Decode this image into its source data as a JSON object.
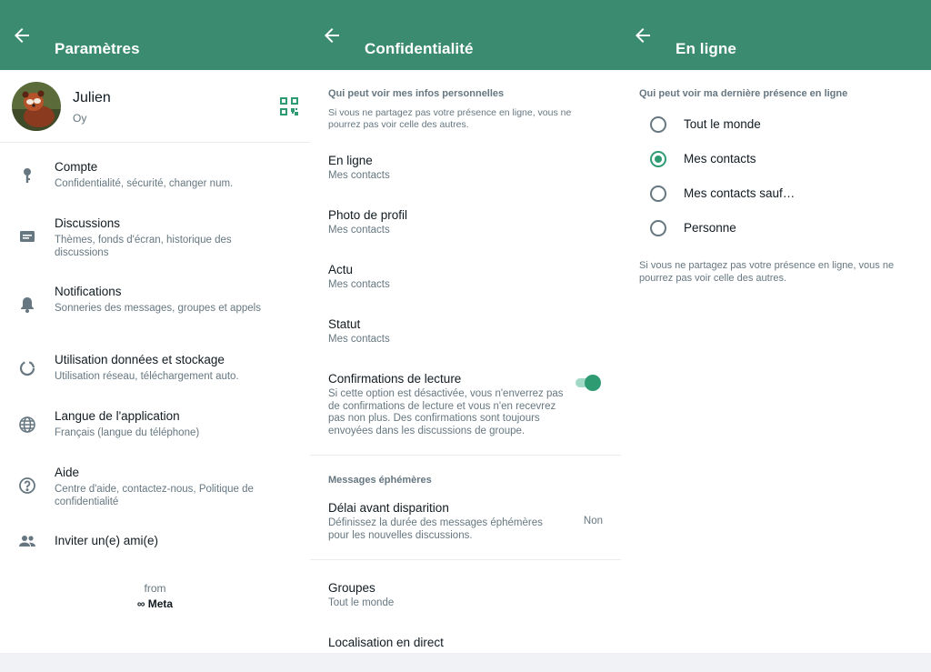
{
  "colors": {
    "header": "#3a8b70",
    "accent": "#2e9b73",
    "secondary_text": "#667781"
  },
  "settings": {
    "title": "Paramètres",
    "profile": {
      "name": "Julien",
      "status": "Oy"
    },
    "items": [
      {
        "icon": "key-icon",
        "title": "Compte",
        "subtitle": "Confidentialité, sécurité, changer num."
      },
      {
        "icon": "chat-icon",
        "title": "Discussions",
        "subtitle": "Thèmes, fonds d'écran, historique des discussions"
      },
      {
        "icon": "bell-icon",
        "title": "Notifications",
        "subtitle": "Sonneries des messages, groupes et appels"
      },
      {
        "icon": "data-usage-icon",
        "title": "Utilisation données et stockage",
        "subtitle": "Utilisation réseau, téléchargement auto."
      },
      {
        "icon": "globe-icon",
        "title": "Langue de l'application",
        "subtitle": "Français (langue du téléphone)"
      },
      {
        "icon": "help-icon",
        "title": "Aide",
        "subtitle": "Centre d'aide, contactez-nous, Politique de confidentialité"
      },
      {
        "icon": "people-icon",
        "title": "Inviter un(e) ami(e)",
        "subtitle": ""
      }
    ],
    "from_label": "from",
    "meta_label": "∞ Meta"
  },
  "privacy": {
    "title": "Confidentialité",
    "section1_header": "Qui peut voir mes infos personnelles",
    "section1_desc": "Si vous ne partagez pas votre présence en ligne, vous ne pourrez pas voir celle des autres.",
    "rows": [
      {
        "title": "En ligne",
        "value": "Mes contacts"
      },
      {
        "title": "Photo de profil",
        "value": "Mes contacts"
      },
      {
        "title": "Actu",
        "value": "Mes contacts"
      },
      {
        "title": "Statut",
        "value": "Mes contacts"
      }
    ],
    "read_receipts": {
      "title": "Confirmations de lecture",
      "desc": "Si cette option est désactivée, vous n'enverrez pas de confirmations de lecture et vous n'en recevrez pas non plus. Des confirmations sont toujours envoyées dans les discussions de groupe.",
      "enabled": true
    },
    "section2_header": "Messages éphémères",
    "disappearing": {
      "title": "Délai avant disparition",
      "desc": "Définissez la durée des messages éphémères pour les nouvelles discussions.",
      "value": "Non"
    },
    "groups": {
      "title": "Groupes",
      "value": "Tout le monde"
    },
    "live_location": {
      "title": "Localisation en direct"
    }
  },
  "online": {
    "title": "En ligne",
    "header": "Qui peut voir ma dernière présence en ligne",
    "options": [
      {
        "label": "Tout le monde",
        "checked": false
      },
      {
        "label": "Mes contacts",
        "checked": true
      },
      {
        "label": "Mes contacts sauf…",
        "checked": false
      },
      {
        "label": "Personne",
        "checked": false
      }
    ],
    "footer": "Si vous ne partagez pas votre présence en ligne, vous ne pourrez pas voir celle des autres."
  }
}
